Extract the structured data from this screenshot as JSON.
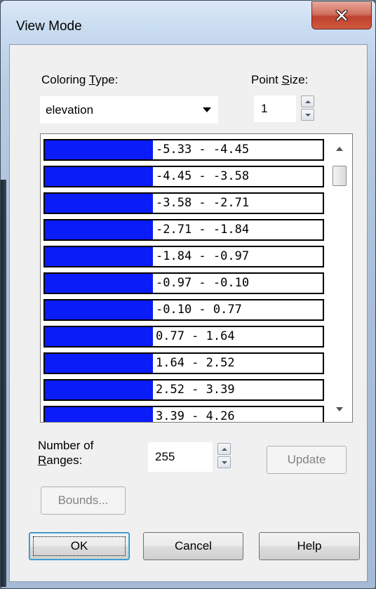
{
  "window": {
    "title": "View Mode"
  },
  "coloring": {
    "label_pre": "Coloring ",
    "label_mnemonic": "T",
    "label_post": "ype:",
    "value": "elevation"
  },
  "point_size": {
    "label_pre": "Point ",
    "label_mnemonic": "S",
    "label_post": "ize:",
    "value": "1"
  },
  "ranges": [
    {
      "label": "-5.33 - -4.45",
      "color": "#0a1cf8"
    },
    {
      "label": "-4.45 - -3.58",
      "color": "#0a1cf8"
    },
    {
      "label": "-3.58 - -2.71",
      "color": "#0a1cf8"
    },
    {
      "label": "-2.71 - -1.84",
      "color": "#0a1cf8"
    },
    {
      "label": "-1.84 - -0.97",
      "color": "#0a1cf8"
    },
    {
      "label": "-0.97 - -0.10",
      "color": "#0a1cf8"
    },
    {
      "label": "-0.10 - 0.77",
      "color": "#0a1cf8"
    },
    {
      "label": "0.77 - 1.64",
      "color": "#0a1cf8"
    },
    {
      "label": "1.64 - 2.52",
      "color": "#0a1cf8"
    },
    {
      "label": "2.52 - 3.39",
      "color": "#0a1cf8"
    },
    {
      "label": "3.39 - 4.26",
      "color": "#0a1cf8"
    }
  ],
  "num_ranges": {
    "label_line1": "Number of",
    "label_line2_mnemonic": "R",
    "label_line2_post": "anges:",
    "value": "255"
  },
  "buttons": {
    "update": "Update",
    "bounds": "Bounds...",
    "ok": "OK",
    "cancel": "Cancel",
    "help": "Help"
  },
  "icons": {
    "close": "close-x-icon",
    "spin_up": "triangle-up-icon",
    "spin_down": "triangle-down-icon",
    "dropdown": "chevron-down-icon"
  }
}
